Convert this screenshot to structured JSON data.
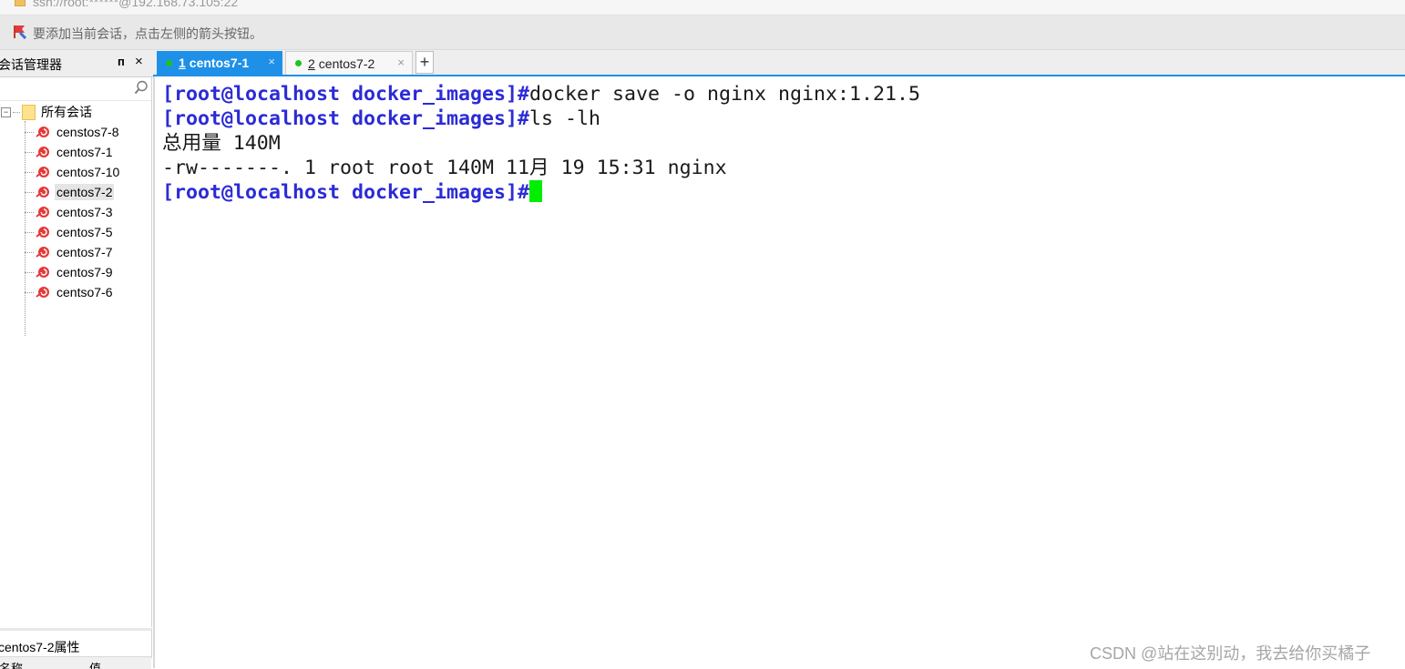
{
  "address_bar": {
    "url": "ssh://root:******@192.168.73.105:22"
  },
  "hint_bar": {
    "text": "要添加当前会话，点击左侧的箭头按钮。"
  },
  "session_manager": {
    "title": "会话管理器",
    "pin_label": "ᴨ",
    "close_label": "×",
    "root_label": "所有会话",
    "expander_label": "−",
    "sessions": [
      "censtos7-8",
      "centos7-1",
      "centos7-10",
      "centos7-2",
      "centos7-3",
      "centos7-5",
      "centos7-7",
      "centos7-9",
      "centso7-6"
    ],
    "selected": "centos7-2"
  },
  "properties": {
    "title": "centos7-2属性",
    "col_name": "名称",
    "col_value": "值"
  },
  "tabs": [
    {
      "number": "1",
      "label": "centos7-1",
      "active": true,
      "close": "×"
    },
    {
      "number": "2",
      "label": "centos7-2",
      "active": false,
      "close": "×"
    }
  ],
  "add_tab_label": "+",
  "terminal": {
    "prompt": "[root@localhost docker_images]#",
    "cmd1": "docker save -o nginx nginx:1.21.5",
    "cmd2": "ls -lh",
    "out1": "总用量 140M",
    "out2": "-rw-------. 1 root root 140M 11月 19 15:31 nginx"
  },
  "watermark": "CSDN @站在这别动，我去给你买橘子",
  "colors": {
    "accent": "#1e90e8",
    "prompt": "#2b2bd6",
    "cursor": "#00ee00",
    "status_dot": "#1bc41b"
  }
}
